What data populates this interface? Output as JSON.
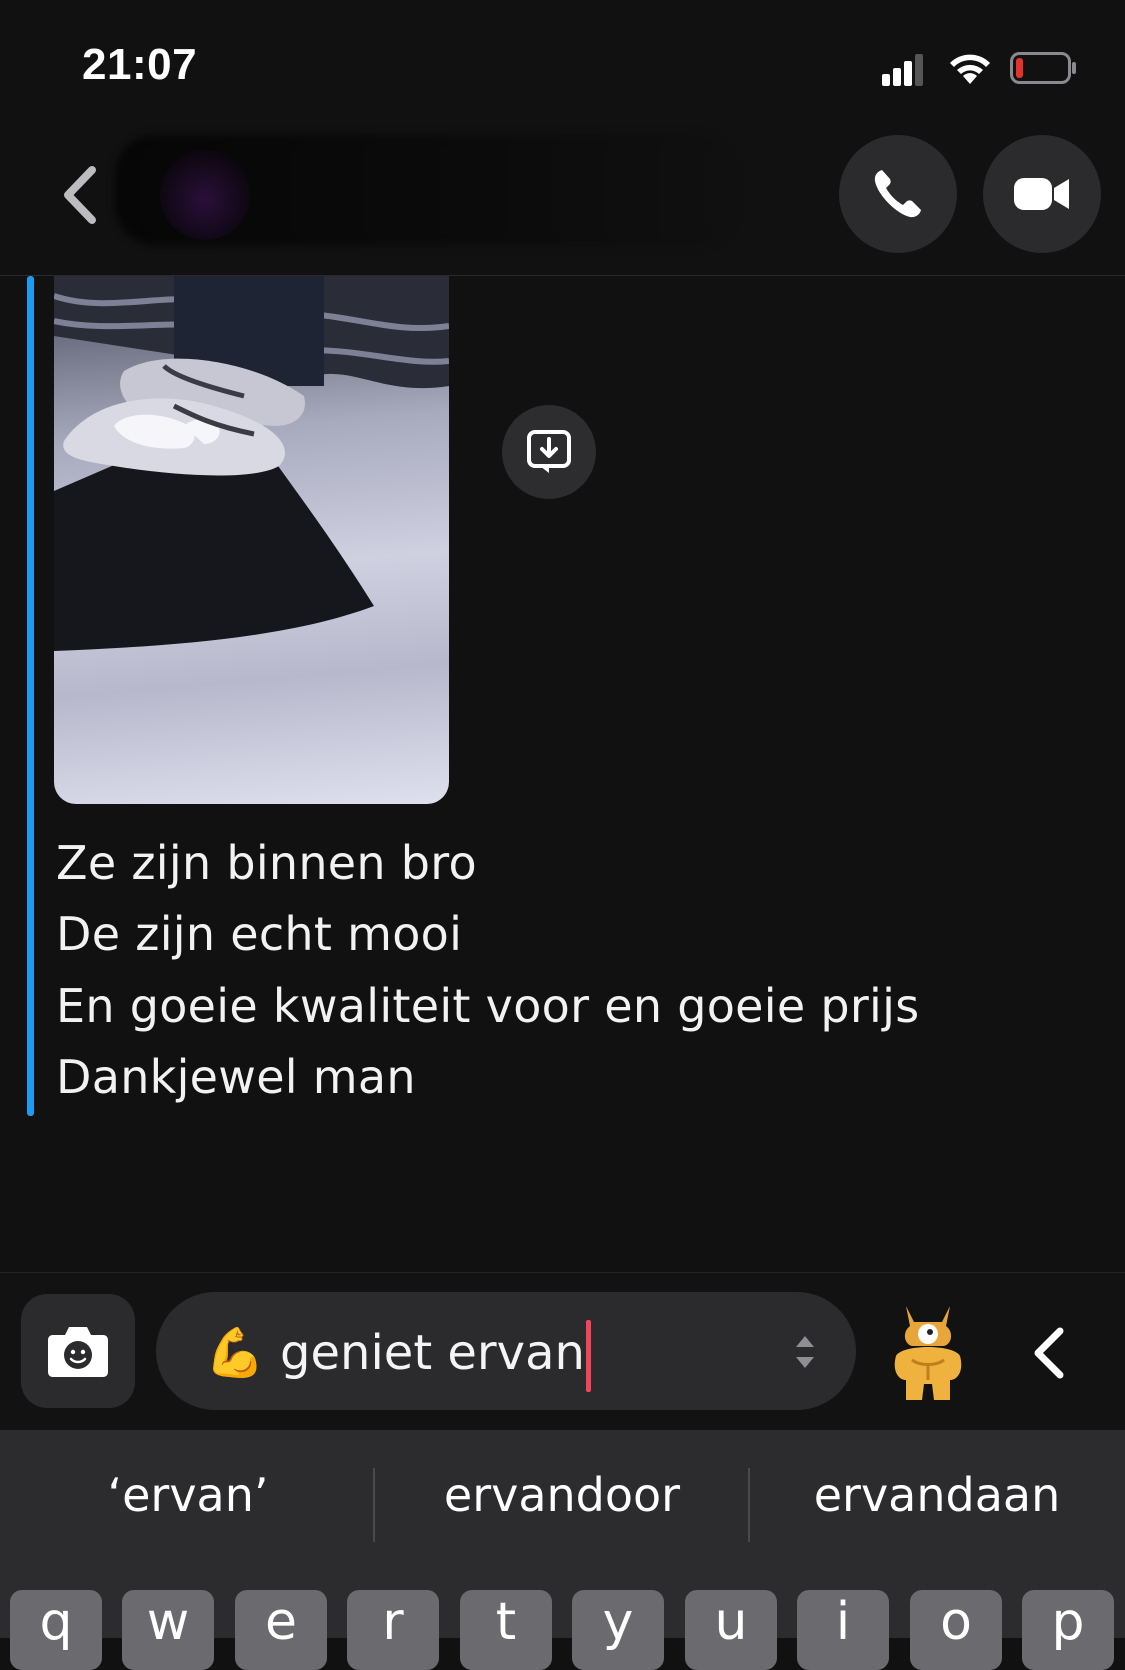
{
  "status_bar": {
    "time": "21:07"
  },
  "chat": {
    "message_lines": [
      "Ze zijn binnen bro",
      "De zijn echt mooi",
      "En goeie kwaliteit voor en goeie prijs",
      "Dankjewel man"
    ],
    "photo_icon": "sneakers-photo"
  },
  "compose": {
    "emoji": "💪",
    "draft_text": "geniet ervan"
  },
  "keyboard": {
    "suggestions": [
      "‘ervan’",
      "ervandoor",
      "ervandaan"
    ],
    "top_row_keys": [
      "q",
      "w",
      "e",
      "r",
      "t",
      "y",
      "u",
      "i",
      "o",
      "p"
    ]
  },
  "colors": {
    "accent_bar": "#1b9cf2",
    "caret": "#f2455b",
    "battery_low": "#e5322d"
  }
}
